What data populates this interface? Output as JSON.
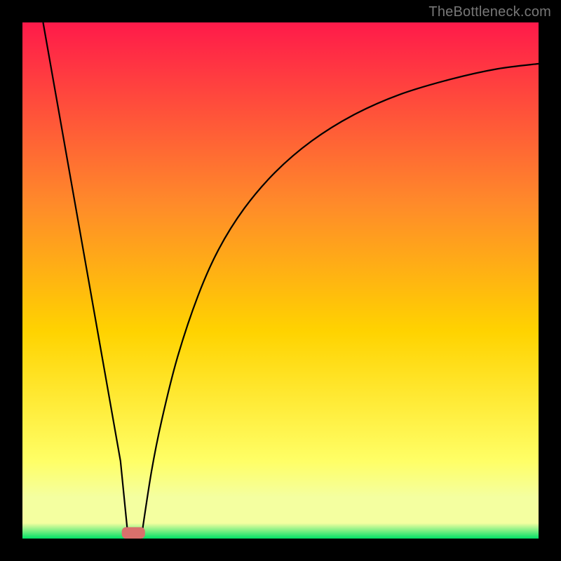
{
  "watermark": "TheBottleneck.com",
  "colors": {
    "frame": "#000000",
    "gradient_top": "#ff1a4a",
    "gradient_mid_upper": "#ff8a2a",
    "gradient_mid": "#ffd300",
    "gradient_mid_lower": "#ffff66",
    "gradient_lower_band": "#f4ffa0",
    "gradient_bottom": "#00e066",
    "curve": "#000000",
    "marker": "#d9706c"
  },
  "chart_data": {
    "type": "line",
    "title": "",
    "xlabel": "",
    "ylabel": "",
    "xlim": [
      0,
      100
    ],
    "ylim": [
      0,
      100
    ],
    "series": [
      {
        "name": "left-segment",
        "x": [
          4,
          7,
          10,
          13,
          16,
          19,
          20.5
        ],
        "values": [
          100,
          83,
          66,
          49,
          32,
          15,
          0
        ]
      },
      {
        "name": "right-segment",
        "x": [
          23,
          25,
          27,
          30,
          34,
          38,
          43,
          49,
          56,
          64,
          73,
          83,
          92,
          100
        ],
        "values": [
          0,
          13,
          23,
          35,
          47,
          56,
          64,
          71,
          77,
          82,
          86,
          89,
          91,
          92
        ]
      }
    ],
    "marker": {
      "x": 21.5,
      "y": 0,
      "width": 4.5,
      "height": 2.2
    },
    "background_bands_y": [
      {
        "y": 0,
        "color_key": "gradient_bottom"
      },
      {
        "y": 3,
        "color_key": "gradient_lower_band"
      },
      {
        "y": 10,
        "color_key": "gradient_mid_lower"
      },
      {
        "y": 35,
        "color_key": "gradient_mid"
      },
      {
        "y": 65,
        "color_key": "gradient_mid_upper"
      },
      {
        "y": 100,
        "color_key": "gradient_top"
      }
    ]
  }
}
